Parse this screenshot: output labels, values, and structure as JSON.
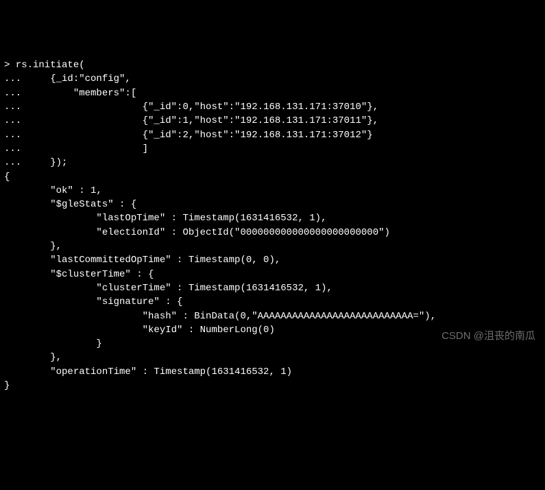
{
  "terminal": {
    "lines": [
      "> rs.initiate(",
      "...     {_id:\"config\",",
      "...         \"members\":[",
      "...                     {\"_id\":0,\"host\":\"192.168.131.171:37010\"},",
      "...                     {\"_id\":1,\"host\":\"192.168.131.171:37011\"},",
      "...                     {\"_id\":2,\"host\":\"192.168.131.171:37012\"}",
      "...                     ]",
      "...     });",
      "{",
      "        \"ok\" : 1,",
      "        \"$gleStats\" : {",
      "                \"lastOpTime\" : Timestamp(1631416532, 1),",
      "                \"electionId\" : ObjectId(\"000000000000000000000000\")",
      "        },",
      "        \"lastCommittedOpTime\" : Timestamp(0, 0),",
      "        \"$clusterTime\" : {",
      "                \"clusterTime\" : Timestamp(1631416532, 1),",
      "                \"signature\" : {",
      "                        \"hash\" : BinData(0,\"AAAAAAAAAAAAAAAAAAAAAAAAAAA=\"),",
      "                        \"keyId\" : NumberLong(0)",
      "                }",
      "        },",
      "        \"operationTime\" : Timestamp(1631416532, 1)",
      "}"
    ]
  },
  "watermark": {
    "text": "CSDN @沮丧的南瓜"
  }
}
